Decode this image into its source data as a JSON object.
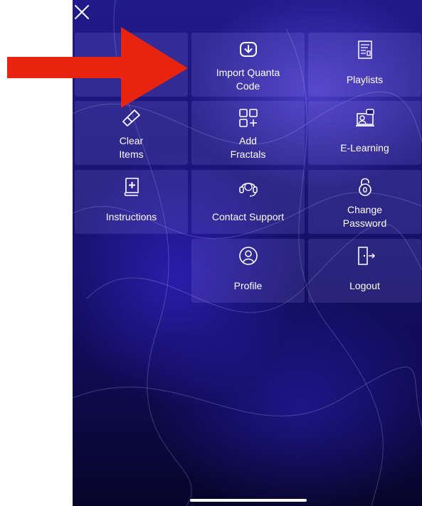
{
  "close_icon": "x-icon",
  "tiles": {
    "t0": {
      "label": "&  ",
      "icon": "none"
    },
    "t1": {
      "label": "Import Quanta\nCode",
      "icon": "download-box-icon"
    },
    "t2": {
      "label": "Playlists",
      "icon": "playlist-icon"
    },
    "t3": {
      "label": "Clear\nItems",
      "icon": "eraser-icon"
    },
    "t4": {
      "label": "Add\nFractals",
      "icon": "grid-plus-icon"
    },
    "t5": {
      "label": "E-Learning",
      "icon": "elearning-icon"
    },
    "t6": {
      "label": "Instructions",
      "icon": "medical-book-icon"
    },
    "t7": {
      "label": "Contact Support",
      "icon": "support-24-icon"
    },
    "t8": {
      "label": "Change\nPassword",
      "icon": "lock-icon"
    },
    "t9": {
      "label": "Profile",
      "icon": "user-icon"
    },
    "t10": {
      "label": "Logout",
      "icon": "logout-icon"
    }
  },
  "colors": {
    "arrow": "#e8230f",
    "text": "#ffffff",
    "background": "#17136f"
  }
}
